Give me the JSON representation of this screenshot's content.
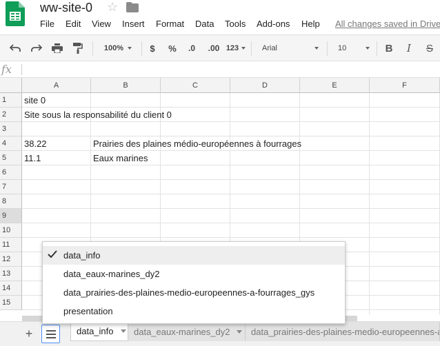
{
  "header": {
    "doc_title": "ww-site-0",
    "menu": [
      "File",
      "Edit",
      "View",
      "Insert",
      "Format",
      "Data",
      "Tools",
      "Add-ons",
      "Help"
    ],
    "saved_status": "All changes saved in Drive"
  },
  "toolbar": {
    "zoom": "100%",
    "currency": "$",
    "percent": "%",
    "decrease_decimals": ".0",
    "increase_decimals": ".00",
    "more_formats": "123",
    "font_family": "Arial",
    "font_size": "10",
    "bold": "B",
    "italic": "I",
    "strikethrough": "S"
  },
  "formula_bar": {
    "fx_label": "fx",
    "value": ""
  },
  "grid": {
    "columns": [
      "A",
      "B",
      "C",
      "D",
      "E",
      "F"
    ],
    "rows": [
      "1",
      "2",
      "3",
      "4",
      "5",
      "6",
      "7",
      "8",
      "9",
      "10",
      "11",
      "12",
      "13",
      "14",
      "15"
    ],
    "cells": {
      "A1": "site 0",
      "A2": "Site sous la responsabilité du client 0",
      "A4": "38.22",
      "B4": "Prairies des plaines médio-européennes à fourrages",
      "A5": "11.1",
      "B5": "Eaux marines"
    }
  },
  "sheet_menu": {
    "items": [
      "data_info",
      "data_eaux-marines_dy2",
      "data_prairies-des-plaines-medio-europeennes-a-fourrages_gys",
      "presentation"
    ],
    "checked": "data_info"
  },
  "sheet_tabs": [
    "data_info",
    "data_eaux-marines_dy2",
    "data_prairies-des-plaines-medio-europeennes-a-fourrages_gys"
  ],
  "active_tab": "data_info",
  "colors": {
    "sheets_green": "#0f9d58",
    "accent_blue": "#4d90fe"
  }
}
